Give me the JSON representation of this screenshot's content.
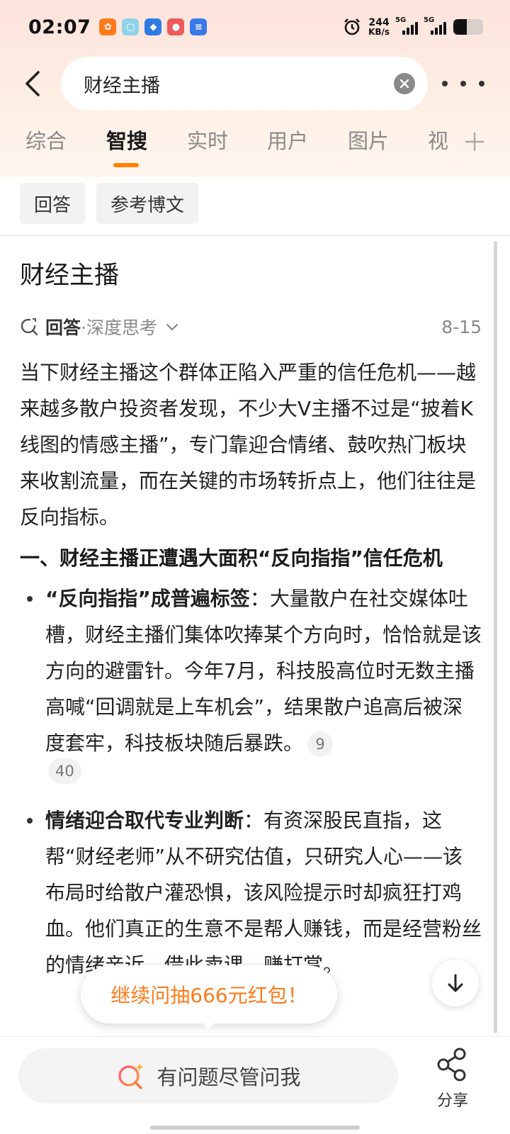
{
  "status_bar": {
    "time": "02:07",
    "net_speed_value": "244",
    "net_speed_unit": "KB/s",
    "sim1": "5G",
    "sim2": "5G",
    "battery_level": 0.45
  },
  "header": {
    "search_query": "财经主播"
  },
  "tabs": [
    {
      "label": "综合",
      "active": false
    },
    {
      "label": "智搜",
      "active": true
    },
    {
      "label": "实时",
      "active": false
    },
    {
      "label": "用户",
      "active": false
    },
    {
      "label": "图片",
      "active": false
    },
    {
      "label": "视",
      "active": false
    }
  ],
  "chips": [
    {
      "label": "回答"
    },
    {
      "label": "参考博文"
    }
  ],
  "answer": {
    "title": "财经主播",
    "label": "回答",
    "mode": "·深度思考",
    "date": "8-15",
    "intro": "当下财经主播这个群体正陷入严重的信任危机——越来越多散户投资者发现，不少大V主播不过是“披着K线图的情感主播”，专门靠迎合情绪、鼓吹热门板块来收割流量，而在关键的市场转折点上，他们往往是反向指标。",
    "section_heading": "一、财经主播正遭遇大面积“反向指指”信任危机",
    "points": [
      {
        "bold": "“反向指指”成普遍标签",
        "text": "：大量散户在社交媒体吐槽，财经主播们集体吹捧某个方向时，恰恰就是该方向的避雷针。今年7月，科技股高位时无数主播高喊“回调就是上车机会”，结果散户追高后被深度套牢，科技板块随后暴跌。",
        "citations": [
          "9",
          "40"
        ]
      },
      {
        "bold": "情绪迎合取代专业判断",
        "text": "：有资深股民直指，这帮“财经老师”从不研究估值，只研究人心——该布局时给散户灌恐惧，该风险提示时却疯狂打鸡血。他们真正的生意不是帮人赚钱，而是经营粉丝的情绪亲近，借此卖课、赚打赏。",
        "citations": []
      }
    ]
  },
  "promo": {
    "text": "继续问抽666元红包！"
  },
  "bottom_bar": {
    "ask_placeholder": "有问题尽管问我",
    "share_label": "分享"
  },
  "colors": {
    "accent": "#ff8200",
    "promo_text": "#ff7a1a",
    "header_gradient_top": "#fde3dc"
  }
}
